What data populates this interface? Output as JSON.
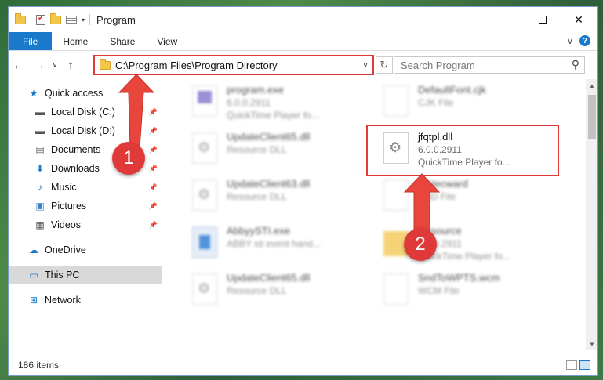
{
  "window": {
    "title": "Program"
  },
  "ribbon": {
    "tabs": [
      "File",
      "Home",
      "Share",
      "View"
    ],
    "help": "?"
  },
  "address_bar": {
    "path": "C:\\Program Files\\Program Directory",
    "search_placeholder": "Search Program"
  },
  "nav": {
    "items": [
      {
        "label": "Quick access",
        "icon": "star-icon",
        "pinned": false
      },
      {
        "label": "Local Disk (C:)",
        "icon": "drive-icon",
        "pinned": true
      },
      {
        "label": "Local Disk (D:)",
        "icon": "drive-icon",
        "pinned": true
      },
      {
        "label": "Documents",
        "icon": "documents-icon",
        "pinned": true
      },
      {
        "label": "Downloads",
        "icon": "download-icon",
        "pinned": true
      },
      {
        "label": "Music",
        "icon": "music-icon",
        "pinned": true
      },
      {
        "label": "Pictures",
        "icon": "pictures-icon",
        "pinned": true
      },
      {
        "label": "Videos",
        "icon": "videos-icon",
        "pinned": true
      },
      {
        "label": "OneDrive",
        "icon": "cloud-icon",
        "pinned": false
      },
      {
        "label": "This PC",
        "icon": "computer-icon",
        "pinned": false,
        "selected": true
      },
      {
        "label": "Network",
        "icon": "network-icon",
        "pinned": false
      }
    ]
  },
  "files": [
    {
      "name": "program.exe",
      "line2": "6.0.0.2911",
      "line3": "QuickTime Player fo...",
      "blurred": true
    },
    {
      "name": "DefaultFont.cjk",
      "line2": "CJK File",
      "line3": "",
      "blurred": true
    },
    {
      "name": "UpdateClient65.dll",
      "line2": "Resource DLL",
      "line3": "",
      "blurred": true
    },
    {
      "name": "jfqtpl.dll",
      "line2": "6.0.0.2911",
      "line3": "QuickTime Player fo...",
      "blurred": false
    },
    {
      "name": "UpdateClient63.dll",
      "line2": "Resource DLL",
      "line3": "",
      "blurred": true
    },
    {
      "name": "Matecward",
      "line2": "SND File",
      "line3": "",
      "blurred": true
    },
    {
      "name": "AbbyySTI.exe",
      "line2": "ABBY sti event hand...",
      "line3": "",
      "blurred": true
    },
    {
      "name": "Resource",
      "line2": "6.0.0.2911",
      "line3": "QuickTime Player fo...",
      "blurred": true
    },
    {
      "name": "UpdateClient65.dll",
      "line2": "Resource DLL",
      "line3": "",
      "blurred": true
    },
    {
      "name": "SndToWPTS.wcm",
      "line2": "WCM File",
      "line3": "",
      "blurred": true
    }
  ],
  "status": {
    "count": "186 items"
  },
  "steps": [
    "1",
    "2"
  ],
  "colors": {
    "accent": "#1979ca",
    "highlight": "#e0393a"
  }
}
